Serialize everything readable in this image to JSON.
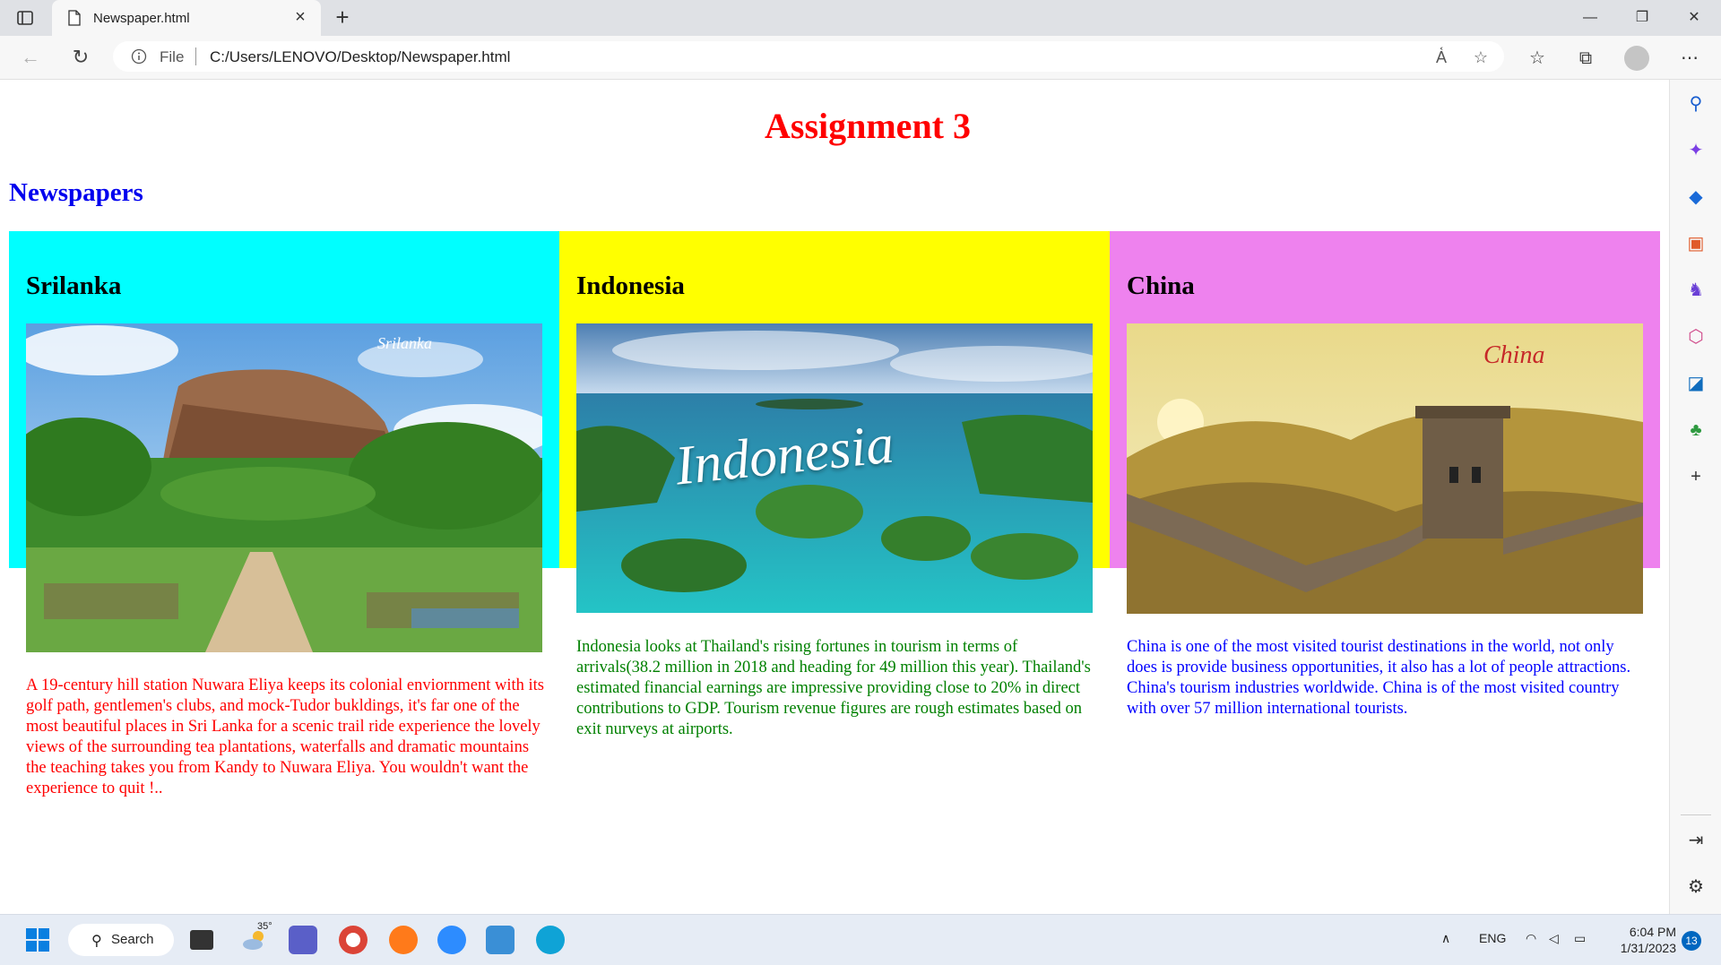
{
  "browser": {
    "tab_title": "Newspaper.html",
    "new_tab": "+",
    "close_tab": "×",
    "window_controls": {
      "minimize": "—",
      "restore": "❐",
      "close": "✕"
    },
    "address": {
      "scheme_label": "File",
      "url": "C:/Users/LENOVO/Desktop/Newspaper.html"
    },
    "icons": [
      "back-icon",
      "refresh-icon",
      "info-icon",
      "read-aloud-icon",
      "add-favorite-icon",
      "favorites-icon",
      "collections-icon",
      "profile-icon",
      "more-icon"
    ]
  },
  "page": {
    "title": "Assignment 3",
    "section": "Newspapers",
    "colors": {
      "title": "#ff0000",
      "section": "#0000ee"
    },
    "columns": [
      {
        "country": "Srilanka",
        "background": "#00ffff",
        "text_color": "#ff0000",
        "image_caption": "Srilanka",
        "description": "A 19-century hill station Nuwara Eliya keeps its colonial enviornment with its golf path, gentlemen's clubs, and mock-Tudor bukldings, it's far one of the most beautiful places in Sri Lanka for a scenic trail ride experience the lovely views of the surrounding tea plantations, waterfalls and dramatic mountains the teaching takes you from Kandy to Nuwara Eliya. You wouldn't want the experience to quit !.."
      },
      {
        "country": "Indonesia",
        "background": "#ffff00",
        "text_color": "#008000",
        "image_caption": "Indonesia",
        "description": "Indonesia looks at Thailand's rising fortunes in tourism in terms of arrivals(38.2 million in 2018 and heading for 49 million this year). Thailand's estimated financial earnings are impressive providing close to 20% in direct contributions to GDP. Tourism revenue figures are rough estimates based on exit nurveys at airports."
      },
      {
        "country": "China",
        "background": "#ee82ee",
        "text_color": "#0000ff",
        "image_caption": "China",
        "description": "China is one of the most visited tourist destinations in the world, not only does is provide business opportunities, it also has a lot of people attractions. China's tourism industries worldwide. China is of the most visited country with over 57 million international tourists."
      }
    ]
  },
  "sidebar": {
    "icons": [
      "search-icon",
      "copilot-icon",
      "shopping-icon",
      "tools-icon",
      "games-icon",
      "office-icon",
      "outlook-icon",
      "tree-icon",
      "add-icon",
      "hide-sidebar-icon",
      "settings-icon"
    ],
    "add_label": "+"
  },
  "taskbar": {
    "search_label": "Search",
    "weather_temp": "35°",
    "language": "ENG",
    "time": "6:04 PM",
    "date": "1/31/2023",
    "notification_count": "13",
    "apps": [
      "start-icon",
      "task-view-icon",
      "weather-icon",
      "teams-icon",
      "chrome-icon",
      "firefox-icon",
      "zoom-icon",
      "store-icon",
      "edge-icon"
    ]
  }
}
